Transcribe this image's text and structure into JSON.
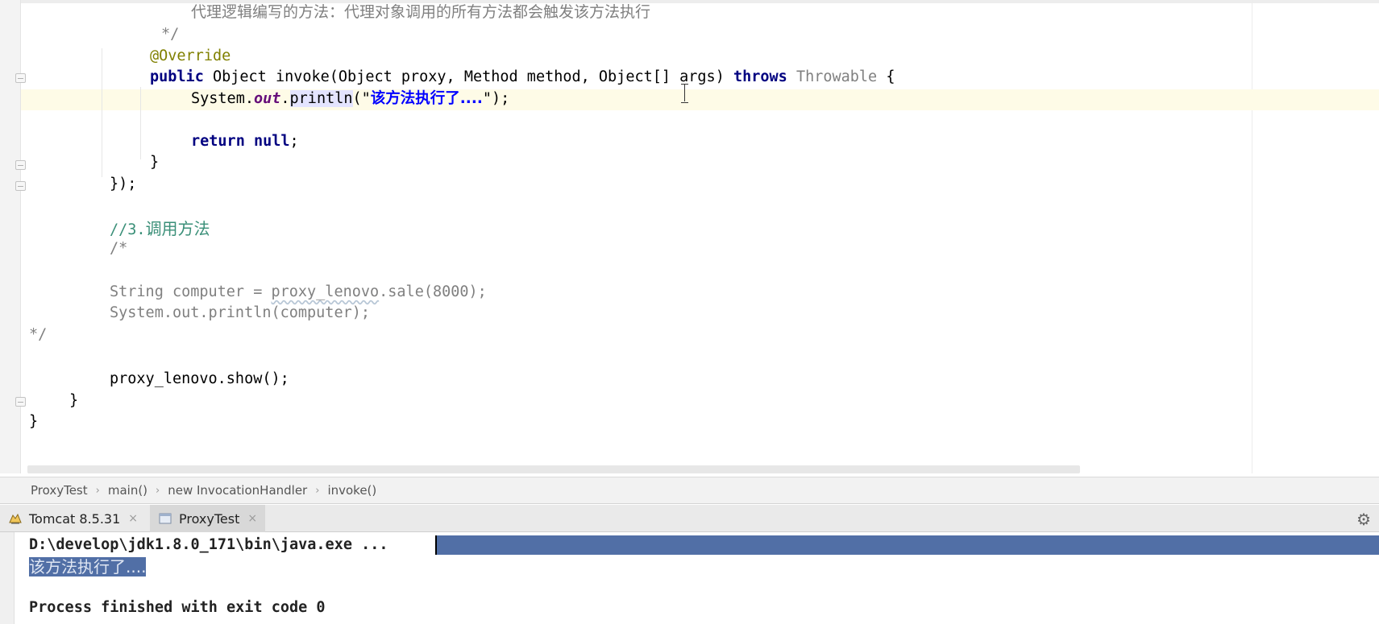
{
  "editor": {
    "lines": {
      "doc_text": "代理逻辑编写的方法：代理对象调用的所有方法都会触发该方法执行",
      "doc_end": "*/",
      "annotation": "@Override",
      "sig_public": "public",
      "sig_object": "Object",
      "sig_invoke": "invoke(Object proxy, Method method, Object[] args)",
      "sig_throws": "throws",
      "sig_throwable": "Throwable",
      "sig_brace": "{",
      "print_system": "System.",
      "print_out": "out",
      "print_dot": ".",
      "print_println": "println",
      "print_open": "(\"",
      "print_string": "该方法执行了....",
      "print_close": "\");",
      "return_kw": "return",
      "return_null": "null",
      "return_semi": ";",
      "close_method": "}",
      "close_handler": "});",
      "comment_step3_prefix": "//3.",
      "comment_step3_text": "调用方法",
      "block_comment_open": "/*",
      "commented_string_a": "String computer = ",
      "commented_proxy": "proxy_lenovo",
      "commented_string_b": ".sale(8000);",
      "commented_print": "System.out.println(computer);",
      "block_comment_close": "*/",
      "show_call": "proxy_lenovo.show();",
      "close_main": "}",
      "close_class": "}"
    }
  },
  "breadcrumb": {
    "items": [
      "ProxyTest",
      "main()",
      "new InvocationHandler",
      "invoke()"
    ],
    "separator": "›"
  },
  "run": {
    "tabs": [
      {
        "label": "Tomcat 8.5.31",
        "icon": "tomcat-icon"
      },
      {
        "label": "ProxyTest",
        "icon": "run-config-icon"
      }
    ],
    "close_glyph": "×",
    "gear_glyph": "⚙",
    "console": {
      "command": "D:\\develop\\jdk1.8.0_171\\bin\\java.exe ...",
      "output": "该方法执行了....",
      "finished": "Process finished with exit code 0"
    }
  }
}
